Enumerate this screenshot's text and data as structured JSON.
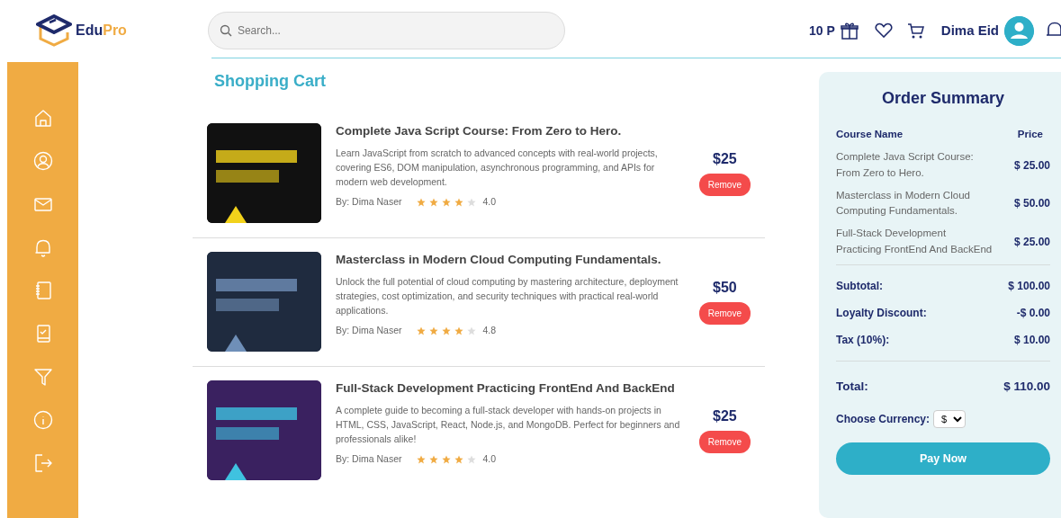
{
  "header": {
    "logo": {
      "part_1": "Edu",
      "part_2": "Pro"
    },
    "search": {
      "placeholder": "Search..."
    },
    "points": "10 P",
    "user_name": "Dima Eid"
  },
  "page_title": "Shopping Cart",
  "cart_items": [
    {
      "title": "Complete Java Script Course: From Zero to Hero.",
      "description": "Learn JavaScript from scratch to advanced concepts with real-world projects, covering ES6, DOM manipulation, asynchronous programming, and APIs for modern web development.",
      "author": "By: Dima Naser",
      "stars": 4,
      "rating": "4.0",
      "price": "$25",
      "remove": "Remove"
    },
    {
      "title": "Masterclass in Modern Cloud Computing Fundamentals.",
      "description": "Unlock the full potential of cloud computing by mastering architecture, deployment strategies, cost optimization, and security techniques with practical real-world applications.",
      "author": "By: Dima Naser",
      "stars": 4,
      "rating": "4.8",
      "price": "$50",
      "remove": "Remove"
    },
    {
      "title": "Full-Stack Development Practicing FrontEnd And BackEnd",
      "description": "A complete guide to becoming a full-stack developer with hands-on projects in HTML, CSS, JavaScript, React, Node.js, and MongoDB. Perfect for beginners and professionals alike!",
      "author": "By: Dima Naser",
      "stars": 4,
      "rating": "4.0",
      "price": "$25",
      "remove": "Remove"
    }
  ],
  "order_summary": {
    "title": "Order Summary",
    "columns": [
      "Course Name",
      "Price"
    ],
    "rows": [
      {
        "name": "Complete Java Script Course: From Zero to Hero.",
        "price": "$ 25.00"
      },
      {
        "name": "Masterclass in Modern Cloud Computing Fundamentals.",
        "price": "$ 50.00"
      },
      {
        "name": "Full-Stack Development Practicing FrontEnd And BackEnd",
        "price": "$ 25.00"
      }
    ],
    "totals": [
      {
        "label": "Subtotal:",
        "value": "$ 100.00"
      },
      {
        "label": "Loyalty Discount:",
        "value": "-$ 0.00"
      },
      {
        "label": "Tax (10%):",
        "value": "$ 10.00"
      }
    ],
    "total": {
      "label": "Total:",
      "value": "$ 110.00"
    },
    "currency": {
      "label": "Choose Currency:",
      "value": "$"
    },
    "pay_button": "Pay Now"
  }
}
